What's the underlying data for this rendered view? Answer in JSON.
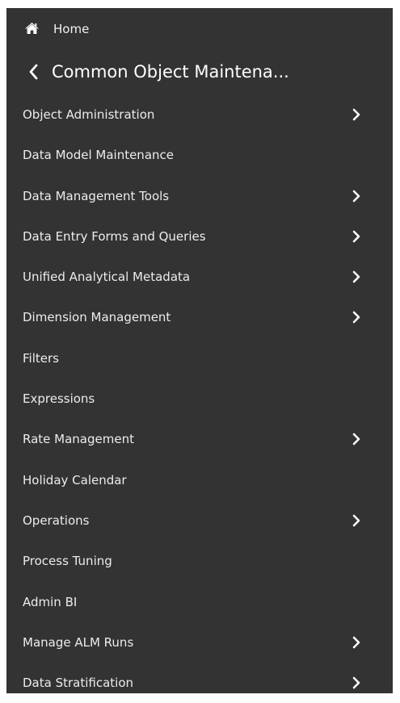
{
  "colors": {
    "panel_bg": "#333333",
    "text": "#ececec",
    "page_bg": "#ffffff"
  },
  "nav": {
    "home": {
      "label": "Home",
      "icon": "home-icon"
    },
    "back": {
      "icon": "chevron-left-icon"
    },
    "section_title": "Common Object Maintena...",
    "items": [
      {
        "label": "Object Administration",
        "has_submenu": true
      },
      {
        "label": "Data Model Maintenance",
        "has_submenu": false
      },
      {
        "label": "Data Management Tools",
        "has_submenu": true
      },
      {
        "label": "Data Entry Forms and Queries",
        "has_submenu": true
      },
      {
        "label": "Unified Analytical Metadata",
        "has_submenu": true
      },
      {
        "label": "Dimension Management",
        "has_submenu": true
      },
      {
        "label": "Filters",
        "has_submenu": false
      },
      {
        "label": "Expressions",
        "has_submenu": false
      },
      {
        "label": "Rate Management",
        "has_submenu": true
      },
      {
        "label": "Holiday Calendar",
        "has_submenu": false
      },
      {
        "label": "Operations",
        "has_submenu": true
      },
      {
        "label": "Process Tuning",
        "has_submenu": false
      },
      {
        "label": "Admin BI",
        "has_submenu": false
      },
      {
        "label": "Manage ALM Runs",
        "has_submenu": true
      },
      {
        "label": "Data Stratification",
        "has_submenu": true
      }
    ]
  }
}
